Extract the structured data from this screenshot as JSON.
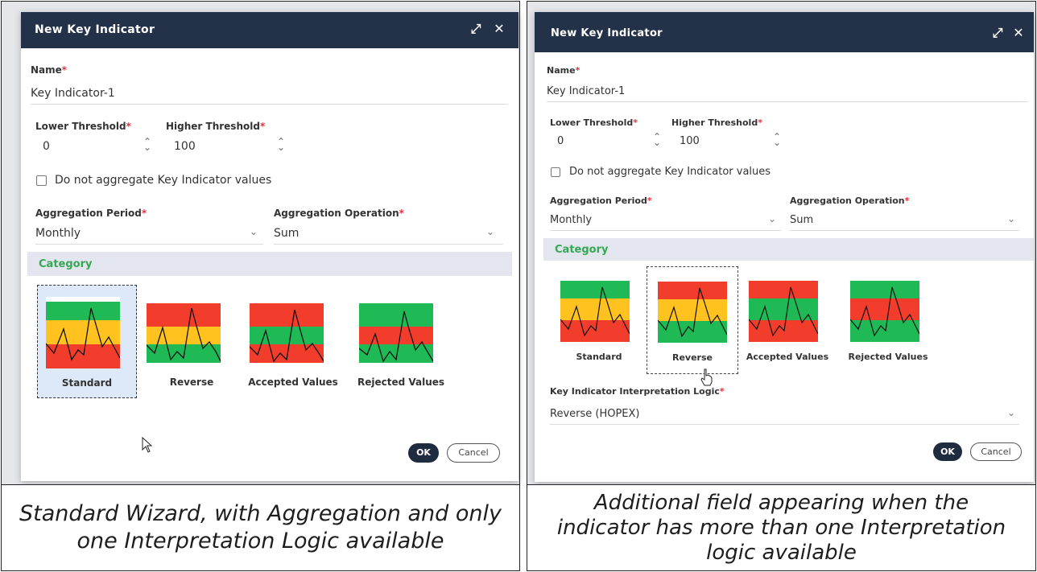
{
  "left": {
    "dialog": {
      "title": "New Key Indicator",
      "name_label": "Name",
      "name_value": "Key Indicator-1",
      "lower_label": "Lower Threshold",
      "lower_value": "0",
      "higher_label": "Higher Threshold",
      "higher_value": "100",
      "checkbox_label": "Do not aggregate Key Indicator values",
      "period_label": "Aggregation Period",
      "period_value": "Monthly",
      "operation_label": "Aggregation Operation",
      "operation_value": "Sum",
      "category_label": "Category",
      "categories": [
        "Standard",
        "Reverse",
        "Accepted Values",
        "Rejected Values"
      ],
      "ok_label": "OK",
      "cancel_label": "Cancel"
    },
    "caption": "Standard Wizard, with Aggregation and only one Interpretation Logic available"
  },
  "right": {
    "dialog": {
      "title": "New Key Indicator",
      "name_label": "Name",
      "name_value": "Key Indicator-1",
      "lower_label": "Lower Threshold",
      "lower_value": "0",
      "higher_label": "Higher Threshold",
      "higher_value": "100",
      "checkbox_label": "Do not aggregate Key Indicator values",
      "period_label": "Aggregation Period",
      "period_value": "Monthly",
      "operation_label": "Aggregation Operation",
      "operation_value": "Sum",
      "category_label": "Category",
      "categories": [
        "Standard",
        "Reverse",
        "Accepted Values",
        "Rejected Values"
      ],
      "logic_label": "Key Indicator Interpretation Logic",
      "logic_value": "Reverse (HOPEX)",
      "ok_label": "OK",
      "cancel_label": "Cancel"
    },
    "caption": "Additional field appearing when the indicator has more than one Interpretation logic available"
  },
  "colors": {
    "titlebar": "#233149",
    "required": "#e0313f",
    "category": "#35a853",
    "green": "#1fb955",
    "yellow": "#ffc21f",
    "red": "#f23c2c"
  },
  "icons": [
    "expand-icon",
    "close-icon",
    "spinner-icon",
    "chevron-down-icon",
    "checkbox-icon",
    "pointer-cursor-icon",
    "hand-cursor-icon"
  ]
}
